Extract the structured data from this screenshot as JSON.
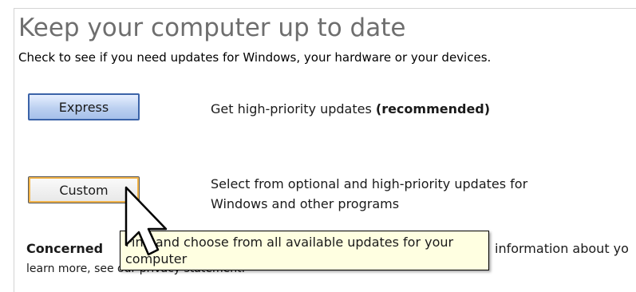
{
  "header": {
    "title": "Keep your computer up to date",
    "subtitle": "Check to see if you need updates for Windows, your hardware or your devices."
  },
  "express": {
    "button_label": "Express",
    "description": "Get high-priority updates ",
    "description_bold": "(recommended)"
  },
  "custom": {
    "button_label": "Custom",
    "description": "Select from optional and high-priority updates for Windows and other programs"
  },
  "privacy": {
    "concerned_label": "Concerned",
    "right_text": "information about yo",
    "learn_more_text": "learn more, see our privacy statement."
  },
  "tooltip": {
    "text": "Find and choose from all available updates for your computer"
  },
  "colors": {
    "title": "#6e6e6e",
    "express_border": "#3b63a8",
    "custom_highlight": "#f2b449",
    "tooltip_bg": "#ffffe1"
  },
  "icons": {
    "cursor": "arrow-cursor-icon"
  }
}
